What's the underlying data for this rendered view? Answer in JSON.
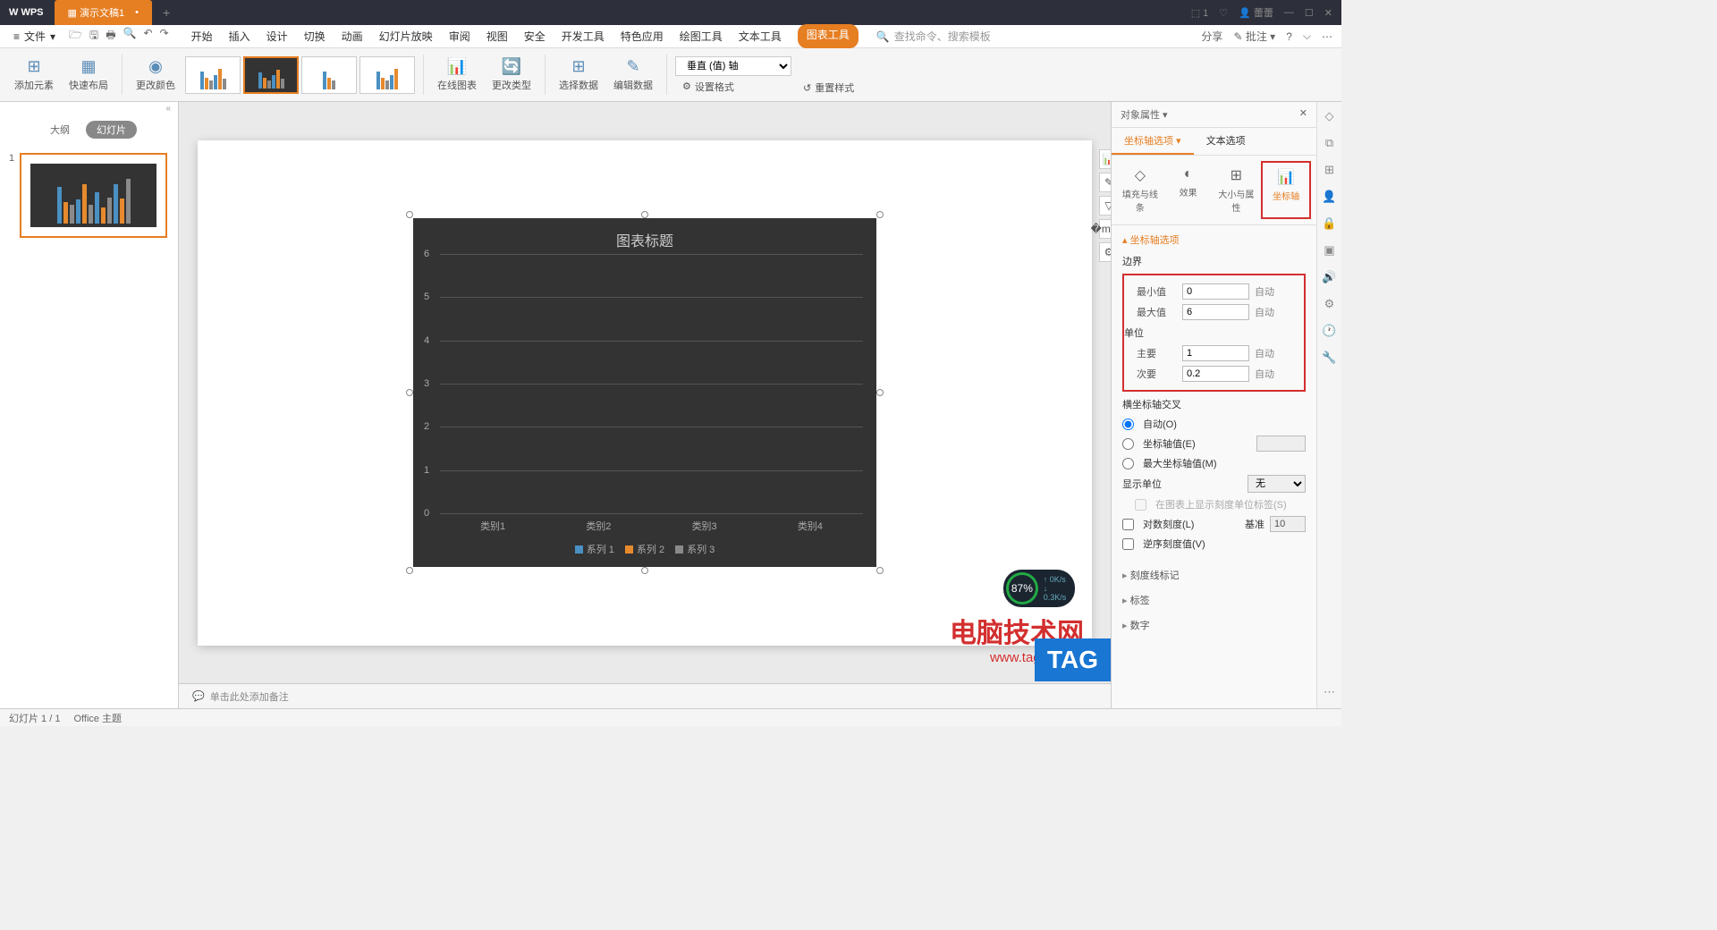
{
  "titlebar": {
    "app": "WPS",
    "doc": "演示文稿1",
    "user": "蕾蕾"
  },
  "menubar": {
    "file": "文件",
    "tabs": [
      "开始",
      "插入",
      "设计",
      "切换",
      "动画",
      "幻灯片放映",
      "审阅",
      "视图",
      "安全",
      "开发工具",
      "特色应用",
      "绘图工具",
      "文本工具",
      "图表工具"
    ],
    "active_tab": "图表工具",
    "search": "查找命令、搜索模板",
    "share": "分享",
    "review": "批注"
  },
  "ribbon": {
    "add_element": "添加元素",
    "quick_layout": "快速布局",
    "change_color": "更改颜色",
    "online_chart": "在线图表",
    "change_type": "更改类型",
    "select_data": "选择数据",
    "edit_data": "编辑数据",
    "axis_dropdown": "垂直 (值) 轴",
    "set_format": "设置格式",
    "reset_style": "重置样式"
  },
  "slide_panel": {
    "outline": "大纲",
    "slides": "幻灯片",
    "num": "1"
  },
  "chart_data": {
    "type": "bar",
    "title": "图表标题",
    "categories": [
      "类别1",
      "类别2",
      "类别3",
      "类别4"
    ],
    "series": [
      {
        "name": "系列 1",
        "color": "#4a90c2",
        "values": [
          4.3,
          2.5,
          3.5,
          4.5
        ]
      },
      {
        "name": "系列 2",
        "color": "#e68a2e",
        "values": [
          2.4,
          4.4,
          1.8,
          2.8
        ]
      },
      {
        "name": "系列 3",
        "color": "#8a8a8a",
        "values": [
          2.0,
          2.0,
          3.0,
          5.0
        ]
      }
    ],
    "ylim": [
      0,
      6
    ],
    "yticks": [
      0,
      1,
      2,
      3,
      4,
      5,
      6
    ]
  },
  "notes": "单击此处添加备注",
  "props": {
    "header": "对象属性",
    "tab_axis": "坐标轴选项",
    "tab_text": "文本选项",
    "sub_fill": "填充与线条",
    "sub_effect": "效果",
    "sub_size": "大小与属性",
    "sub_axis": "坐标轴",
    "section_axis_options": "坐标轴选项",
    "bounds": "边界",
    "min": "最小值",
    "min_val": "0",
    "max": "最大值",
    "max_val": "6",
    "unit": "单位",
    "major": "主要",
    "major_val": "1",
    "minor": "次要",
    "minor_val": "0.2",
    "auto": "自动",
    "cross": "横坐标轴交叉",
    "cross_auto": "自动(O)",
    "cross_val": "坐标轴值(E)",
    "cross_max": "最大坐标轴值(M)",
    "display_unit": "显示单位",
    "display_unit_val": "无",
    "show_label": "在图表上显示刻度单位标签(S)",
    "log_scale": "对数刻度(L)",
    "log_base": "基准",
    "log_base_val": "10",
    "reverse": "逆序刻度值(V)",
    "tick_marks": "刻度线标记",
    "labels": "标签",
    "numbers": "数字"
  },
  "statusbar": {
    "slide": "幻灯片 1 / 1",
    "theme": "Office 主题"
  },
  "perf": {
    "pct": "87%",
    "up": "0K/s",
    "down": "0.3K/s"
  },
  "watermark": {
    "title": "电脑技术网",
    "url": "www.tagxp.com",
    "tag": "TAG"
  }
}
